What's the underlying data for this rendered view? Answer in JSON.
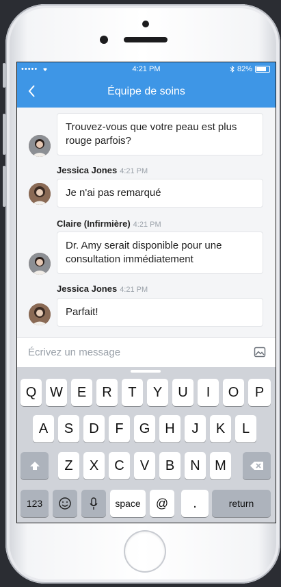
{
  "status": {
    "carrier": "•••••",
    "time": "4:21 PM",
    "battery": "82%"
  },
  "nav": {
    "title": "Équipe de soins"
  },
  "messages": [
    {
      "sender": "",
      "time": "",
      "text": "Trouvez-vous que votre peau est plus rouge parfois?"
    },
    {
      "sender": "Jessica Jones",
      "time": "4:21 PM",
      "text": "Je n'ai pas remarqué"
    },
    {
      "sender": "Claire (Infirmière)",
      "time": "4:21 PM",
      "text": "Dr. Amy serait disponible pour une consultation immédiatement"
    },
    {
      "sender": "Jessica Jones",
      "time": "4:21 PM",
      "text": "Parfait!"
    }
  ],
  "composer": {
    "placeholder": "Écrivez un message"
  },
  "keyboard": {
    "row1": [
      "Q",
      "W",
      "E",
      "R",
      "T",
      "Y",
      "U",
      "I",
      "O",
      "P"
    ],
    "row2": [
      "A",
      "S",
      "D",
      "F",
      "G",
      "H",
      "J",
      "K",
      "L"
    ],
    "row3": [
      "Z",
      "X",
      "C",
      "V",
      "B",
      "N",
      "M"
    ],
    "numbers": "123",
    "space": "space",
    "at": "@",
    "dot": ".",
    "return": "return"
  },
  "icons": [
    "back-chevron-icon",
    "wifi-icon",
    "bluetooth-icon",
    "battery-icon",
    "image-icon",
    "shift-icon",
    "backspace-icon",
    "emoji-icon",
    "microphone-icon"
  ]
}
